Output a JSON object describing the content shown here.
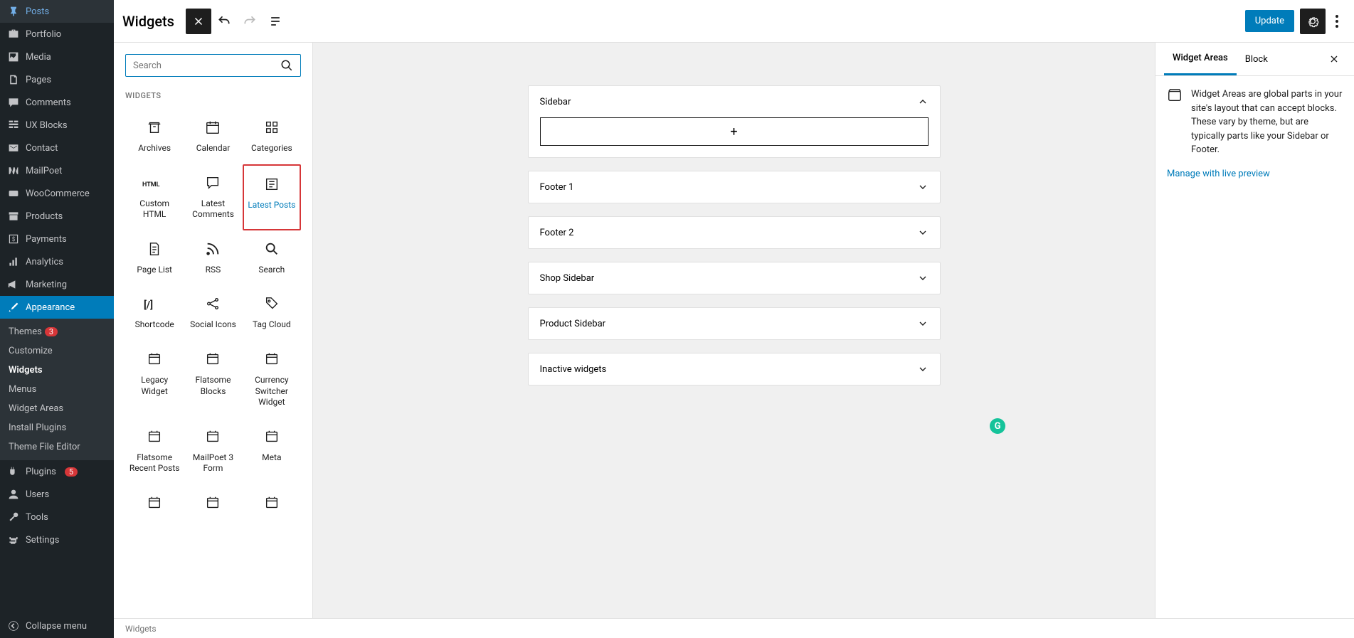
{
  "admin_menu": {
    "posts": "Posts",
    "portfolio": "Portfolio",
    "media": "Media",
    "pages": "Pages",
    "comments": "Comments",
    "ux_blocks": "UX Blocks",
    "contact": "Contact",
    "mailpoet": "MailPoet",
    "woocommerce": "WooCommerce",
    "products": "Products",
    "payments": "Payments",
    "analytics": "Analytics",
    "marketing": "Marketing",
    "appearance": "Appearance",
    "plugins": "Plugins",
    "users": "Users",
    "tools": "Tools",
    "settings": "Settings",
    "collapse": "Collapse menu",
    "themes_badge": "3",
    "plugins_badge": "5"
  },
  "appearance_submenu": {
    "themes": "Themes",
    "customize": "Customize",
    "widgets": "Widgets",
    "menus": "Menus",
    "widget_areas": "Widget Areas",
    "install_plugins": "Install Plugins",
    "theme_file_editor": "Theme File Editor"
  },
  "topbar": {
    "title": "Widgets",
    "update": "Update"
  },
  "inserter": {
    "search_placeholder": "Search",
    "section": "WIDGETS",
    "widgets": [
      {
        "label": "Archives"
      },
      {
        "label": "Calendar"
      },
      {
        "label": "Categories"
      },
      {
        "label": "Custom HTML"
      },
      {
        "label": "Latest Comments"
      },
      {
        "label": "Latest Posts",
        "highlighted": true
      },
      {
        "label": "Page List"
      },
      {
        "label": "RSS"
      },
      {
        "label": "Search"
      },
      {
        "label": "Shortcode"
      },
      {
        "label": "Social Icons"
      },
      {
        "label": "Tag Cloud"
      },
      {
        "label": "Legacy Widget"
      },
      {
        "label": "Flatsome Blocks"
      },
      {
        "label": "Currency Switcher Widget"
      },
      {
        "label": "Flatsome Recent Posts"
      },
      {
        "label": "MailPoet 3 Form"
      },
      {
        "label": "Meta"
      }
    ]
  },
  "areas": [
    {
      "name": "Sidebar",
      "open": true
    },
    {
      "name": "Footer 1",
      "open": false
    },
    {
      "name": "Footer 2",
      "open": false
    },
    {
      "name": "Shop Sidebar",
      "open": false
    },
    {
      "name": "Product Sidebar",
      "open": false
    },
    {
      "name": "Inactive widgets",
      "open": false
    }
  ],
  "settings": {
    "tab1": "Widget Areas",
    "tab2": "Block",
    "description": "Widget Areas are global parts in your site's layout that can accept blocks. These vary by theme, but are typically parts like your Sidebar or Footer.",
    "link": "Manage with live preview"
  },
  "footer": {
    "breadcrumb": "Widgets"
  }
}
